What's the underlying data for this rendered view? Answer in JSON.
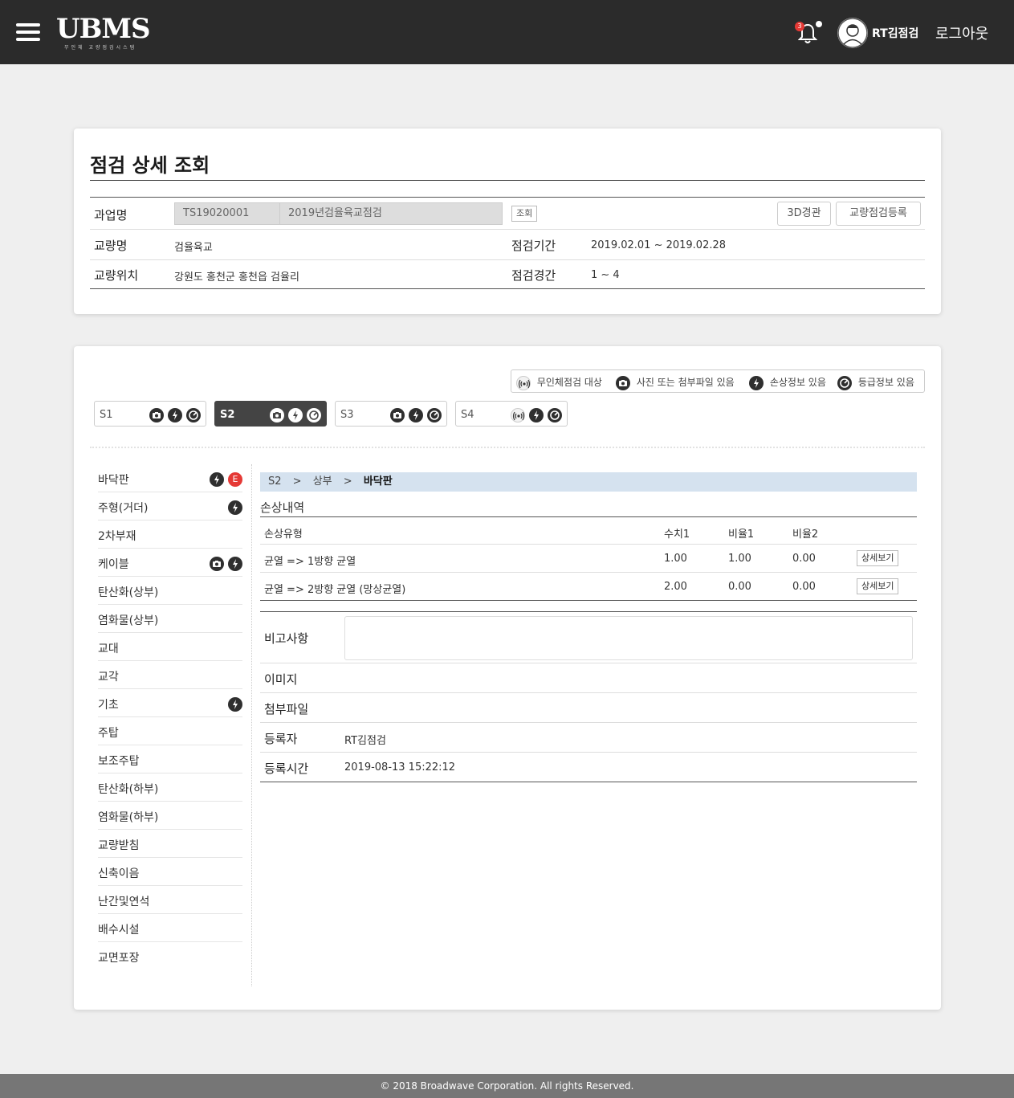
{
  "header": {
    "logo_text": "UBMS",
    "logo_sub": "무인체 교량점검시스템",
    "notification_count": "3",
    "username": "RT김점검",
    "logout_label": "로그아웃"
  },
  "detail_card": {
    "title": "점검 상세 조회",
    "rows": {
      "project": {
        "label": "과업명",
        "code": "TS19020001",
        "name": "2019년검율육교점검",
        "lookup_label": "조회",
        "btn_3d": "3D경관",
        "btn_register": "교량점검등록"
      },
      "bridge": {
        "label": "교량명",
        "value": "검율육교",
        "period_label": "점검기간",
        "period_value": "2019.02.01 ~ 2019.02.28"
      },
      "location": {
        "label": "교량위치",
        "value": "강원도 홍천군 홍천읍 검율리",
        "span_label": "점검경간",
        "span_value": "1 ~ 4"
      }
    }
  },
  "legend": {
    "drone": "무인체점검 대상",
    "photo": "사진 또는 첨부파일 있음",
    "damage": "손상정보 있음",
    "grade": "등급정보 있음"
  },
  "spans": [
    {
      "name": "S1"
    },
    {
      "name": "S2"
    },
    {
      "name": "S3"
    },
    {
      "name": "S4"
    }
  ],
  "members": [
    {
      "label": "바닥판"
    },
    {
      "label": "주형(거더)"
    },
    {
      "label": "2차부재"
    },
    {
      "label": "케이블"
    },
    {
      "label": "탄산화(상부)"
    },
    {
      "label": "염화물(상부)"
    },
    {
      "label": "교대"
    },
    {
      "label": "교각"
    },
    {
      "label": "기초"
    },
    {
      "label": "주탑"
    },
    {
      "label": "보조주탑"
    },
    {
      "label": "탄산화(하부)"
    },
    {
      "label": "염화물(하부)"
    },
    {
      "label": "교량받침"
    },
    {
      "label": "신축이음"
    },
    {
      "label": "난간및연석"
    },
    {
      "label": "배수시설"
    },
    {
      "label": "교면포장"
    }
  ],
  "grade_badge": "E",
  "breadcrumb": {
    "span": "S2",
    "sep": ">",
    "part": "상부",
    "member": "바닥판"
  },
  "damage": {
    "section_title": "손상내역",
    "headers": [
      "손상유형",
      "수치1",
      "비율1",
      "비율2"
    ],
    "detail_label": "상세보기",
    "rows": [
      {
        "type": "균열 => 1방향 균열",
        "v1": "1.00",
        "r1": "1.00",
        "r2": "0.00"
      },
      {
        "type": "균열 => 2방향 균열 (망상균열)",
        "v1": "2.00",
        "r1": "0.00",
        "r2": "0.00"
      }
    ]
  },
  "meta": {
    "remark_label": "비고사항",
    "image_label": "이미지",
    "attach_label": "첨부파일",
    "registrant_label": "등록자",
    "registrant_value": "RT김점검",
    "time_label": "등록시간",
    "time_value": "2019-08-13 15:22:12"
  },
  "footer": "© 2018 Broadwave Corporation. All rights Reserved.",
  "colors": {
    "topbar": "#2b2b2b",
    "breadcrumb_bg": "#d5e2ef",
    "grade_red": "#e53935",
    "footer": "#767676"
  }
}
